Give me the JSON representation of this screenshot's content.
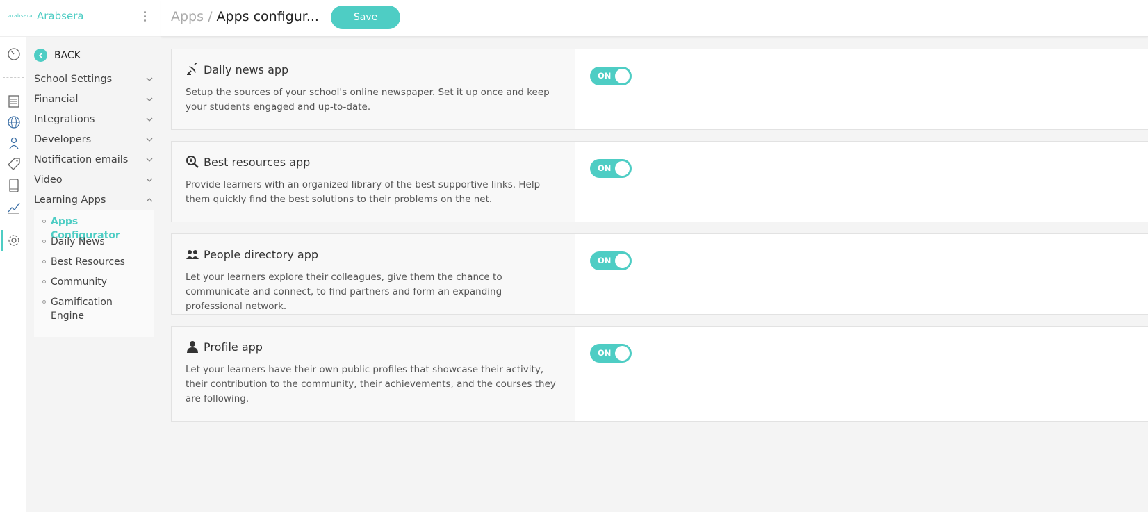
{
  "brand": {
    "logo_text": "arabsera",
    "name": "Arabsera"
  },
  "colors": {
    "accent": "#4ecdc4",
    "text": "#333333",
    "muted": "#aaaaaa"
  },
  "rail_icons": [
    "speedometer-icon",
    "document-icon",
    "globe-icon",
    "person-icon",
    "tag-icon",
    "tablet-icon",
    "chart-icon",
    "gear-icon"
  ],
  "sidebar": {
    "back_label": "BACK",
    "items": [
      {
        "label": "School Settings",
        "expanded": false
      },
      {
        "label": "Financial",
        "expanded": false
      },
      {
        "label": "Integrations",
        "expanded": false
      },
      {
        "label": "Developers",
        "expanded": false
      },
      {
        "label": "Notification emails",
        "expanded": false
      },
      {
        "label": "Video",
        "expanded": false
      },
      {
        "label": "Learning Apps",
        "expanded": true
      }
    ],
    "subitems": [
      {
        "label": "Apps Configurator",
        "active": true
      },
      {
        "label": "Daily News",
        "active": false
      },
      {
        "label": "Best Resources",
        "active": false
      },
      {
        "label": "Community",
        "active": false
      },
      {
        "label": "Gamification Engine",
        "active": false
      }
    ]
  },
  "header": {
    "crumb_parent": "Apps",
    "crumb_separator": "/",
    "crumb_current": "Apps configur...",
    "save_label": "Save"
  },
  "apps": [
    {
      "icon": "satellite-dish-icon",
      "title": "Daily news app",
      "description": "Setup the sources of your school's online newspaper. Set it up once and keep your students engaged and up-to-date.",
      "toggle_label": "ON",
      "enabled": true
    },
    {
      "icon": "search-star-icon",
      "title": "Best resources app",
      "description": "Provide learners with an organized library of the best supportive links. Help them quickly find the best solutions to their problems on the net.",
      "toggle_label": "ON",
      "enabled": true
    },
    {
      "icon": "people-icon",
      "title": "People directory app",
      "description": "Let your learners explore their colleagues, give them the chance to communicate and connect, to find partners and form an expanding professional network.",
      "toggle_label": "ON",
      "enabled": true
    },
    {
      "icon": "user-icon",
      "title": "Profile app",
      "description": "Let your learners have their own public profiles that showcase their activity, their contribution to the community, their achievements, and the courses they are following.",
      "toggle_label": "ON",
      "enabled": true
    }
  ]
}
